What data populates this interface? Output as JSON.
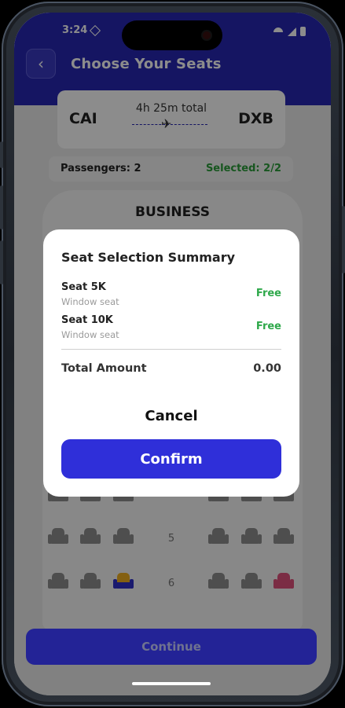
{
  "status_bar": {
    "time": "3:24"
  },
  "header": {
    "title": "Choose Your Seats",
    "back_icon": "chevron-left-icon"
  },
  "flight": {
    "origin": "CAI",
    "destination": "DXB",
    "duration": "4h 25m total"
  },
  "passengers": {
    "label": "Passengers: 2",
    "selected": "Selected: 2/2"
  },
  "cabin": {
    "class_title": "BUSINESS",
    "rows": [
      "5",
      "6"
    ]
  },
  "modal": {
    "title": "Seat Selection Summary",
    "seats": [
      {
        "label": "Seat 5K",
        "type": "Window seat",
        "price": "Free"
      },
      {
        "label": "Seat 10K",
        "type": "Window seat",
        "price": "Free"
      }
    ],
    "total_label": "Total Amount",
    "total_value": "0.00",
    "cancel_label": "Cancel",
    "confirm_label": "Confirm"
  },
  "footer": {
    "continue_label": "Continue"
  },
  "colors": {
    "brand": "#2727b3",
    "confirm": "#2f2fd9",
    "success": "#2ea84a",
    "seat_available": "#8f8f8f",
    "seat_selected_1": "#f0b020",
    "seat_selected_2": "#e0507c"
  }
}
